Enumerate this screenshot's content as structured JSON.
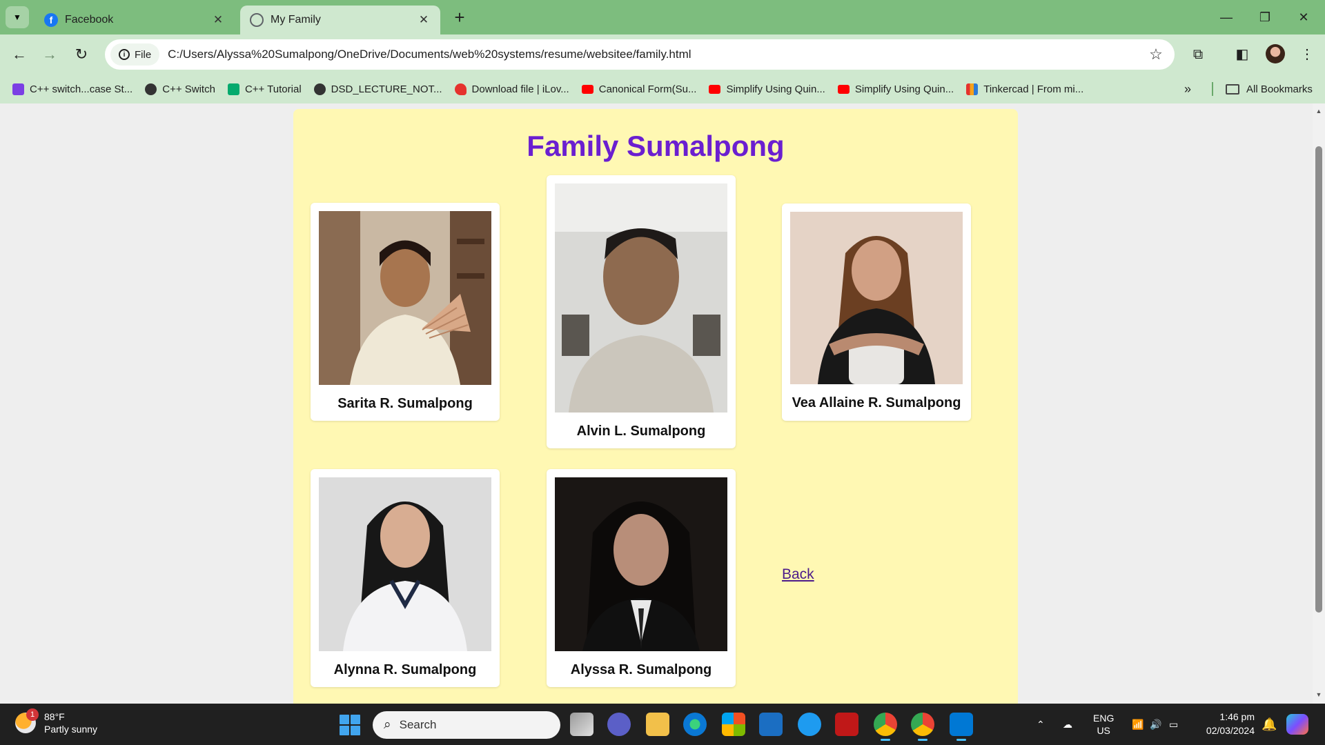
{
  "browser": {
    "tabs": [
      {
        "title": "Facebook",
        "active": false
      },
      {
        "title": "My Family",
        "active": true
      }
    ],
    "address": {
      "scheme_chip": "File",
      "url": "C:/Users/Alyssa%20Sumalpong/OneDrive/Documents/web%20systems/resume/websitee/family.html"
    },
    "bookmarks": [
      {
        "label": "C++ switch...case St...",
        "icon_color": "#7b3fe4"
      },
      {
        "label": "C++ Switch",
        "icon_color": "#333333"
      },
      {
        "label": "C++ Tutorial",
        "icon_color": "#04aa6d"
      },
      {
        "label": "DSD_LECTURE_NOT...",
        "icon_color": "#333333"
      },
      {
        "label": "Download file | iLov...",
        "icon_color": "#e5322d"
      },
      {
        "label": "Canonical Form(Su...",
        "icon_color": "#ff0000"
      },
      {
        "label": "Simplify Using Quin...",
        "icon_color": "#ff0000"
      },
      {
        "label": "Simplify Using Quin...",
        "icon_color": "#ff0000"
      },
      {
        "label": "Tinkercad | From mi...",
        "icon_color": "#f7a21b"
      }
    ],
    "bookmarks_more": "»",
    "all_bookmarks": "All Bookmarks"
  },
  "page": {
    "title": "Family Sumalpong",
    "members": [
      {
        "name": "Sarita R. Sumalpong"
      },
      {
        "name": "Alvin L. Sumalpong"
      },
      {
        "name": "Vea Allaine R. Sumalpong"
      },
      {
        "name": "Alynna R. Sumalpong"
      },
      {
        "name": "Alyssa R. Sumalpong"
      }
    ],
    "back_link": "Back",
    "colors": {
      "title": "#6b1fd0",
      "panel": "#fff8b3",
      "background": "#eeeeee"
    }
  },
  "taskbar": {
    "weather": {
      "temp": "88°F",
      "condition": "Partly sunny",
      "badge": "1"
    },
    "search_placeholder": "Search",
    "language": {
      "line1": "ENG",
      "line2": "US"
    },
    "clock": {
      "time": "1:46 pm",
      "date": "02/03/2024"
    }
  }
}
